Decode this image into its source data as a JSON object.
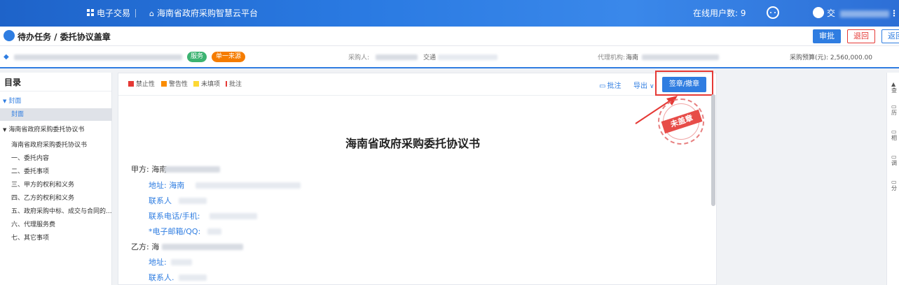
{
  "topbar": {
    "module_label": "电子交易",
    "platform_label": "海南省政府采购智慧云平台",
    "online_users_label": "在线用户数: 9",
    "user_name": "交"
  },
  "subbar": {
    "breadcrumb": "待办任务 / 委托协议盖章",
    "approve_label": "审批",
    "return_label": "退回",
    "back_label": "返回"
  },
  "infobar": {
    "tag_service": "服务",
    "tag_source": "单一来源",
    "buyer_label": "采购人:",
    "buyer_suffix": "交通",
    "agency_label": "代理机构:",
    "agency_value": "海南",
    "budget_label": "采购预算(元): 2,560,000.00"
  },
  "sidebar": {
    "title": "目录",
    "items": [
      {
        "label": "封面",
        "kind": "group",
        "expanded": true
      },
      {
        "label": "封面",
        "kind": "child-selected"
      },
      {
        "label": "海南省政府采购委托协议书",
        "kind": "group",
        "expanded": true
      },
      {
        "label": "海南省政府采购委托协议书",
        "kind": "child"
      },
      {
        "label": "一、委托内容",
        "kind": "child"
      },
      {
        "label": "二、委托事项",
        "kind": "child"
      },
      {
        "label": "三、甲方的权利和义务",
        "kind": "child"
      },
      {
        "label": "四、乙方的权利和义务",
        "kind": "child"
      },
      {
        "label": "五、政府采购中标、成交与合同的...",
        "kind": "child"
      },
      {
        "label": "六、代理服务费",
        "kind": "child"
      },
      {
        "label": "七、其它事项",
        "kind": "child"
      }
    ]
  },
  "toolbar": {
    "legend": [
      {
        "label": "禁止性",
        "color": "#e53935"
      },
      {
        "label": "警告性",
        "color": "#fb8c00"
      },
      {
        "label": "未填项",
        "color": "#fdd835"
      },
      {
        "label": "批注",
        "color": "#e53935",
        "bar": true
      }
    ],
    "comment_label": "批注",
    "export_label": "导出",
    "sign_label": "签章/撤章"
  },
  "document": {
    "title": "海南省政府采购委托协议书",
    "stamp_text": "未盖章",
    "party_a_label": "甲方:",
    "party_a_value": "海南",
    "address_label": "地址:",
    "address_value": "海南",
    "contact_label": "联系人",
    "phone_label": "联系电话/手机:",
    "email_label": "*电子邮箱/QQ:",
    "party_b_label": "乙方:",
    "party_b_value": "海",
    "address_b_label": "地址:",
    "contact_b_label": "联系人."
  },
  "rightstrip": {
    "items": [
      "查",
      "历",
      "相",
      "调",
      "分"
    ]
  },
  "colors": {
    "primary": "#2f7de1",
    "danger": "#e53935",
    "tag_green": "#3cb371",
    "tag_orange": "#f57c00",
    "highlight_box": "#e53935"
  }
}
